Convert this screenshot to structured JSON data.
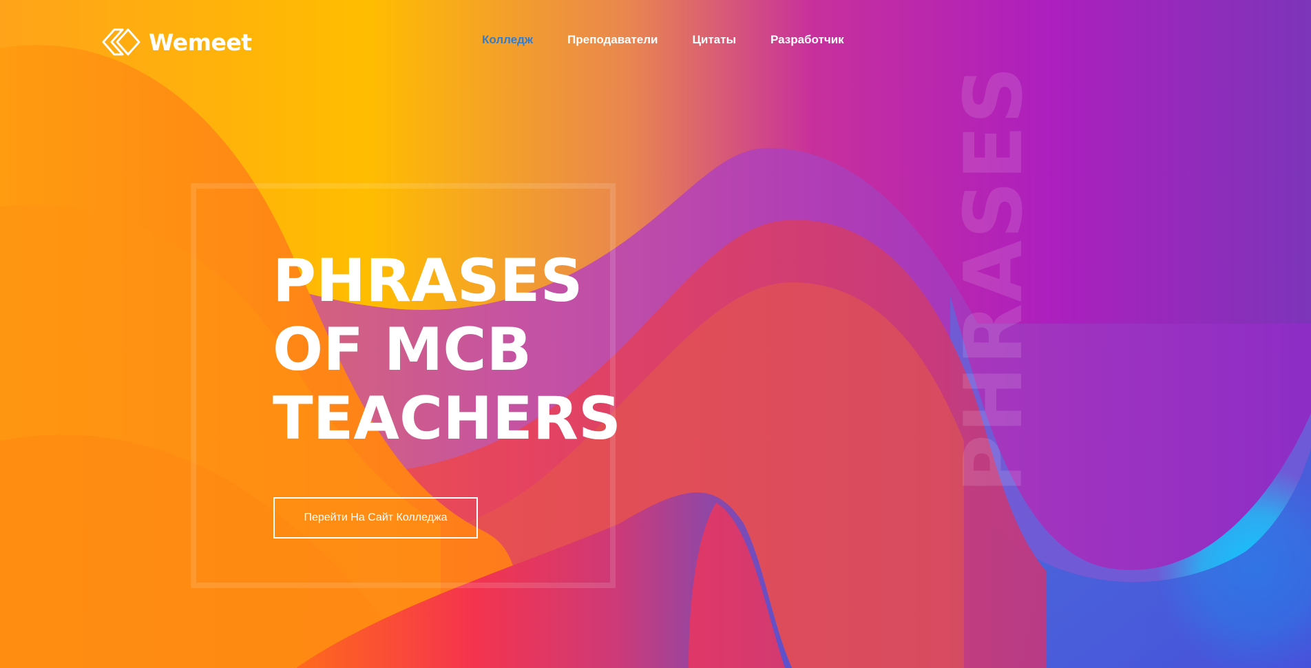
{
  "header": {
    "brand": "Wemeet",
    "nav": [
      {
        "label": "Колледж",
        "active": true
      },
      {
        "label": "Преподаватели",
        "active": false
      },
      {
        "label": "Цитаты",
        "active": false
      },
      {
        "label": "Разработчик",
        "active": false
      }
    ]
  },
  "hero": {
    "title_lines": [
      "PHRASES",
      "OF MCB",
      "TEACHERS"
    ],
    "cta_label": "Перейти На Сайт Колледжа",
    "vertical_word": "PHRASES"
  },
  "colors": {
    "active_nav": "#2f7dd1",
    "orange": "#ff9a12",
    "yellow": "#ffc000",
    "magenta": "#b21fc4",
    "pink": "#f2306b",
    "cyan": "#14c3ff"
  },
  "icons": {
    "logo": "wemeet-logo-icon"
  }
}
